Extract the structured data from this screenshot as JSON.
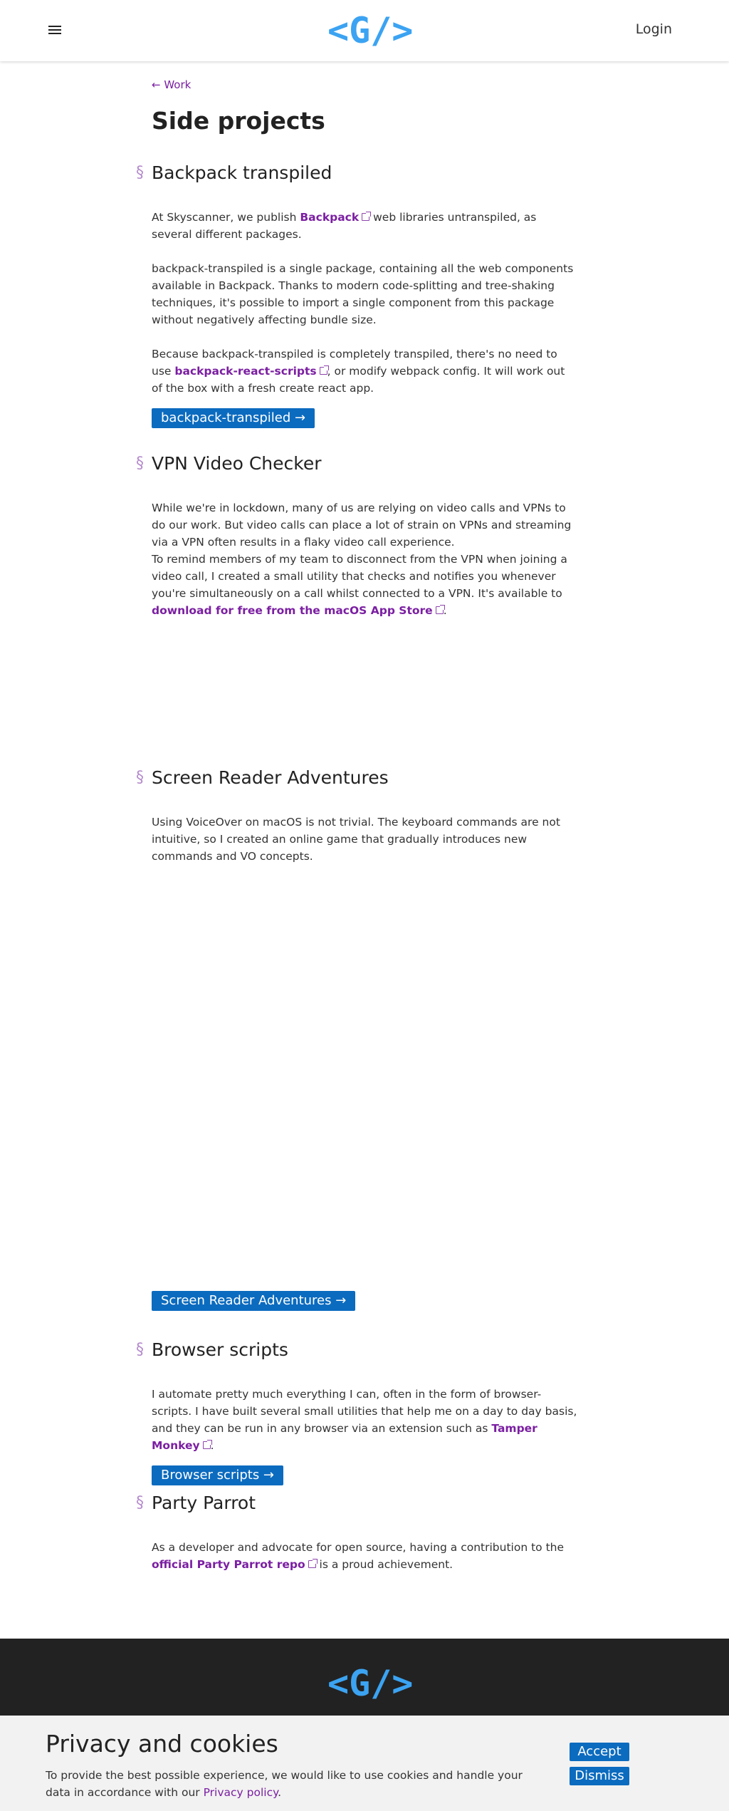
{
  "header": {
    "logo": "<G/>",
    "login": "Login"
  },
  "nav": {
    "back_label": "← Work"
  },
  "page_title": "Side projects",
  "sections": [
    {
      "mark": "§",
      "title": "Backpack transpiled",
      "p1_a": "At Skyscanner, we publish ",
      "p1_link": "Backpack",
      "p1_b": " web libraries untranspiled, as several different packages.",
      "p2": "backpack-transpiled is a single package, containing all the web components available in Backpack. Thanks to modern code-splitting and tree-shaking techniques, it's possible to import a single component from this package without negatively affecting bundle size.",
      "p3_a": "Because backpack-transpiled is completely transpiled, there's no need to use ",
      "p3_link": "backpack-react-scripts",
      "p3_b": ", or modify webpack config. It will work out of the box with a fresh create react app.",
      "button": "backpack-transpiled →"
    },
    {
      "mark": "§",
      "title": "VPN Video Checker",
      "p1": "While we're in lockdown, many of us are relying on video calls and VPNs to do our work. But video calls can place a lot of strain on VPNs and streaming via a VPN often results in a flaky video call experience.",
      "p2_a": "To remind members of my team to disconnect from the VPN when joining a video call, I created a small utility that checks and notifies you whenever you're simultaneously on a call whilst connected to a VPN. It's available to ",
      "p2_link": "download for free from the macOS App Store",
      "p2_b": "."
    },
    {
      "mark": "§",
      "title": "Screen Reader Adventures",
      "p1": "Using VoiceOver on macOS is not trivial. The keyboard commands are not intuitive, so I created an online game that gradually introduces new commands and VO concepts.",
      "button": "Screen Reader Adventures →"
    },
    {
      "mark": "§",
      "title": "Browser scripts",
      "p1_a": "I automate pretty much everything I can, often in the form of browser-scripts. I have built several small utilities that help me on a day to day basis, and they can be run in any browser via an extension such as ",
      "p1_link": "Tamper Monkey",
      "p1_b": ".",
      "button": "Browser scripts →"
    },
    {
      "mark": "§",
      "title": "Party Parrot",
      "p1_a": "As a developer and advocate for open source, having a contribution to the ",
      "p1_link": "official Party Parrot repo",
      "p1_b": " is a proud achievement."
    }
  ],
  "footer": {
    "logo": "<G/>"
  },
  "cookie": {
    "title": "Privacy and cookies",
    "text": "To provide the best possible experience, we would like to use cookies and handle your data in accordance with our ",
    "link": "Privacy policy",
    "text_end": ".",
    "accept": "Accept",
    "dismiss": "Dismiss"
  },
  "colors": {
    "accent_blue": "#3ba3f2",
    "button_blue": "#0b6bbf",
    "link_purple": "#7b1fa2"
  }
}
